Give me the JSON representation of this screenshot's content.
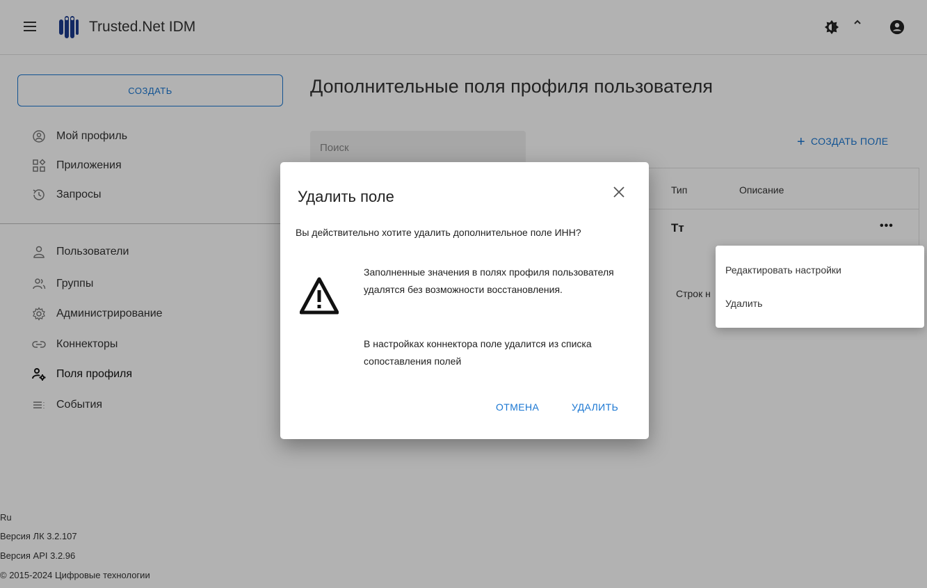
{
  "header": {
    "app_title": "Trusted.Net IDM"
  },
  "sidebar": {
    "create_label": "СОЗДАТЬ",
    "items": [
      {
        "label": "Мой профиль",
        "icon": "profile-icon"
      },
      {
        "label": "Приложения",
        "icon": "apps-icon"
      },
      {
        "label": "Запросы",
        "icon": "history-icon"
      },
      {
        "label": "Пользователи",
        "icon": "user-icon"
      },
      {
        "label": "Группы",
        "icon": "group-icon"
      },
      {
        "label": "Администрирование",
        "icon": "gear-icon"
      },
      {
        "label": "Коннекторы",
        "icon": "link-icon"
      },
      {
        "label": "Поля профиля",
        "icon": "profile-fields-icon"
      },
      {
        "label": "События",
        "icon": "events-icon"
      }
    ],
    "active_item": "Поля профиля",
    "footer": {
      "lang": "Ru",
      "lk_version": "Версия ЛК 3.2.107",
      "api_version": "Версия API 3.2.96",
      "copyright": "© 2015-2024 Цифровые технологии"
    }
  },
  "main": {
    "title": "Дополнительные поля профиля пользователя",
    "search_placeholder": "Поиск",
    "create_field_label": "СОЗДАТЬ ПОЛЕ",
    "columns": {
      "type": "Тип",
      "description": "Описание"
    },
    "row_type_glyph": "Тт",
    "row_menu": "•••",
    "rows_label": "Строк н"
  },
  "context_menu": {
    "items": [
      "Редактировать настройки",
      "Удалить"
    ]
  },
  "dialog": {
    "title": "Удалить поле",
    "question": "Вы действительно хотите удалить дополнительное поле ИНН?",
    "warning_1": "Заполненные значения в полях профиля пользователя удалятся без возможности восстановления.",
    "warning_2": "В настройках коннектора поле удалится из списка сопоставления полей",
    "cancel_label": "ОТМЕНА",
    "delete_label": "УДАЛИТЬ"
  },
  "colors": {
    "accent": "#1976d2",
    "overlay": "rgba(0,0,0,0.30)"
  }
}
